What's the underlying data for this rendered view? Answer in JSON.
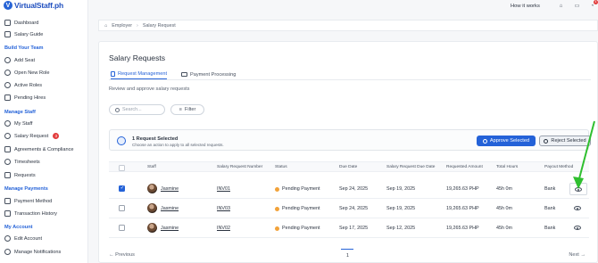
{
  "brand": {
    "name": "VirtualStaff.ph",
    "accent": "#2462d8"
  },
  "topbar": {
    "how_it_works": "How it works",
    "notif_count": "4"
  },
  "sidebar": {
    "items_top": [
      {
        "label": "Dashboard",
        "icon": "dashboard-icon"
      },
      {
        "label": "Salary Guide",
        "icon": "book-icon"
      }
    ],
    "sections": [
      {
        "title": "Build Your Team",
        "items": [
          {
            "label": "Add Seat",
            "icon": "add-user-icon"
          },
          {
            "label": "Open New Role",
            "icon": "plus-circle-icon"
          },
          {
            "label": "Active Roles",
            "icon": "users-icon"
          },
          {
            "label": "Pending Hires",
            "icon": "briefcase-icon"
          }
        ]
      },
      {
        "title": "Manage Staff",
        "items": [
          {
            "label": "My Staff",
            "icon": "users-icon"
          },
          {
            "label": "Salary Request",
            "icon": "dollar-icon",
            "badge": "3"
          },
          {
            "label": "Agreements & Compliance",
            "icon": "handshake-icon"
          },
          {
            "label": "Timesheets",
            "icon": "clock-icon"
          },
          {
            "label": "Requests",
            "icon": "send-icon"
          }
        ]
      },
      {
        "title": "Manage Payments",
        "items": [
          {
            "label": "Payment Method",
            "icon": "card-icon"
          },
          {
            "label": "Transaction History",
            "icon": "swap-icon"
          }
        ]
      },
      {
        "title": "My Account",
        "items": [
          {
            "label": "Edit Account",
            "icon": "user-icon"
          },
          {
            "label": "Manage Notifications",
            "icon": "bell-icon"
          }
        ]
      }
    ]
  },
  "breadcrumb": {
    "parent": "Employer",
    "current": "Salary Request"
  },
  "page": {
    "title": "Salary Requests",
    "tabs": [
      {
        "label": "Request Management",
        "active": true
      },
      {
        "label": "Payment Processing",
        "active": false
      }
    ],
    "subtitle": "Review and approve salary requests",
    "search_placeholder": "Search...",
    "filter_label": "Filter"
  },
  "selection": {
    "title": "1 Request Selected",
    "subtitle": "Choose an action to apply to all selected requests.",
    "approve_label": "Approve Selected",
    "reject_label": "Reject Selected"
  },
  "table": {
    "columns": [
      "Staff",
      "Salary Request Number",
      "Status",
      "Due Date",
      "Salary Request Due Date",
      "Requested Amount",
      "Total Hours",
      "Payout Method"
    ],
    "rows": [
      {
        "checked": true,
        "staff": "Jasmine",
        "number": "INV01",
        "status": "Pending Payment",
        "due": "Sep 24, 2025",
        "req_due": "Sep 19, 2025",
        "amount": "19,265.63 PHP",
        "hours": "45h 0m",
        "payout": "Bank"
      },
      {
        "checked": false,
        "staff": "Jasmine",
        "number": "INV03",
        "status": "Pending Payment",
        "due": "Sep 24, 2025",
        "req_due": "Sep 19, 2025",
        "amount": "19,265.63 PHP",
        "hours": "45h 0m",
        "payout": "Bank"
      },
      {
        "checked": false,
        "staff": "Jasmine",
        "number": "INV02",
        "status": "Pending Payment",
        "due": "Sep 17, 2025",
        "req_due": "Sep 12, 2025",
        "amount": "19,265.63 PHP",
        "hours": "45h 0m",
        "payout": "Bank"
      }
    ]
  },
  "pagination": {
    "prev": "Previous",
    "next": "Next",
    "page": "1"
  }
}
